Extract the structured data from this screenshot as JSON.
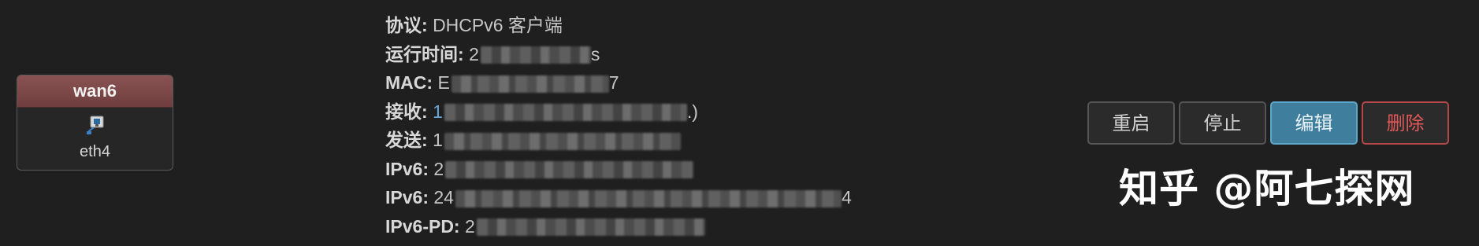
{
  "interface": {
    "name": "wan6",
    "device": "eth4",
    "header_color": "#7a4848"
  },
  "details": [
    {
      "label": "协议:",
      "value": "DHCPv6 客户端"
    },
    {
      "label": "运行时间:",
      "value": "2",
      "tail": "s"
    },
    {
      "label": "MAC:",
      "value": "E",
      "tail": "7"
    },
    {
      "label": "接收:",
      "value": "1",
      "tail": ".)"
    },
    {
      "label": "发送:",
      "value": "1"
    },
    {
      "label": "IPv6:",
      "value": "2"
    },
    {
      "label": "IPv6:",
      "value": "24",
      "tail": "4"
    },
    {
      "label": "IPv6-PD:",
      "value": "2"
    }
  ],
  "actions": {
    "restart": "重启",
    "stop": "停止",
    "edit": "编辑",
    "delete": "删除",
    "edit_color": "#3f7e9c",
    "delete_color": "#e0595a"
  },
  "watermark": "知乎 @阿七探网"
}
